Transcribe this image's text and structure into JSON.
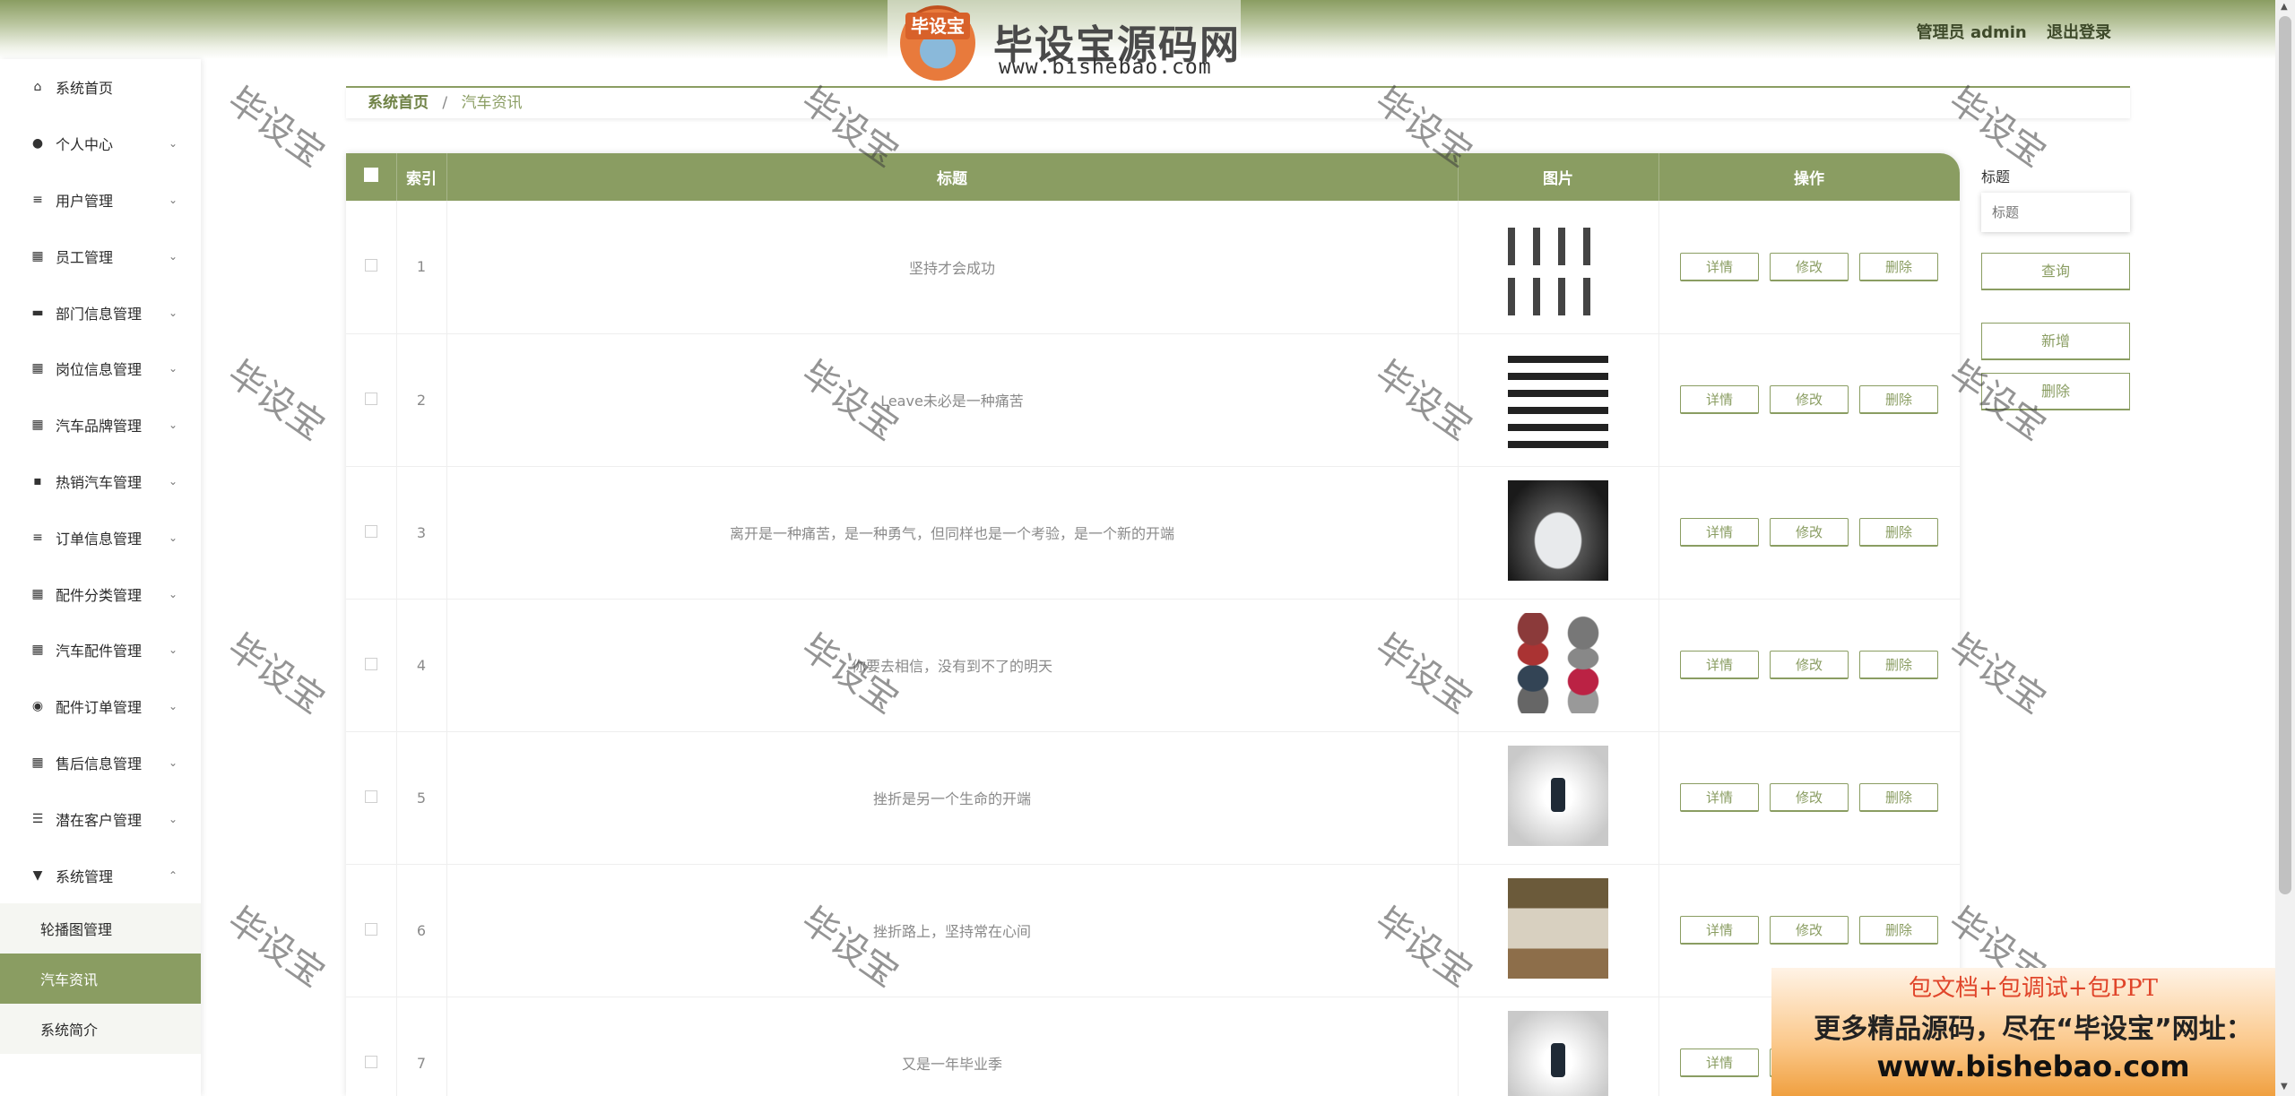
{
  "header": {
    "logo_badge": "毕设宝",
    "logo_title": "毕设宝源码网",
    "logo_url": "www.bishebao.com",
    "user_label": "管理员 admin",
    "logout_label": "退出登录"
  },
  "sidebar": {
    "items": [
      {
        "label": "系统首页",
        "icon": "home-icon",
        "glyph": "⌂",
        "chevron": ""
      },
      {
        "label": "个人中心",
        "icon": "user-icon",
        "glyph": "●",
        "chevron": "⌄"
      },
      {
        "label": "用户管理",
        "icon": "list-icon",
        "glyph": "≡",
        "chevron": "⌄"
      },
      {
        "label": "员工管理",
        "icon": "chart-icon",
        "glyph": "▦",
        "chevron": "⌄"
      },
      {
        "label": "部门信息管理",
        "icon": "ticket-icon",
        "glyph": "▬",
        "chevron": "⌄"
      },
      {
        "label": "岗位信息管理",
        "icon": "grid-icon",
        "glyph": "▦",
        "chevron": "⌄"
      },
      {
        "label": "汽车品牌管理",
        "icon": "grid-icon",
        "glyph": "▦",
        "chevron": "⌄"
      },
      {
        "label": "热销汽车管理",
        "icon": "comment-icon",
        "glyph": "▪",
        "chevron": "⌄"
      },
      {
        "label": "订单信息管理",
        "icon": "list-icon",
        "glyph": "≡",
        "chevron": "⌄"
      },
      {
        "label": "配件分类管理",
        "icon": "grid-icon",
        "glyph": "▦",
        "chevron": "⌄"
      },
      {
        "label": "汽车配件管理",
        "icon": "grid-icon",
        "glyph": "▦",
        "chevron": "⌄"
      },
      {
        "label": "配件订单管理",
        "icon": "location-icon",
        "glyph": "◉",
        "chevron": "⌄"
      },
      {
        "label": "售后信息管理",
        "icon": "grid-icon",
        "glyph": "▦",
        "chevron": "⌄"
      },
      {
        "label": "潜在客户管理",
        "icon": "sliders-icon",
        "glyph": "☰",
        "chevron": "⌄"
      },
      {
        "label": "系统管理",
        "icon": "settings-icon",
        "glyph": "▼",
        "chevron": "⌃"
      }
    ],
    "submenu": [
      {
        "label": "轮播图管理",
        "active": false
      },
      {
        "label": "汽车资讯",
        "active": true
      },
      {
        "label": "系统简介",
        "active": false
      }
    ]
  },
  "breadcrumb": {
    "home": "系统首页",
    "separator": "/",
    "current": "汽车资讯"
  },
  "table": {
    "headers": {
      "index": "索引",
      "title": "标题",
      "image": "图片",
      "actions": "操作"
    },
    "actions": {
      "detail": "详情",
      "edit": "修改",
      "delete": "删除"
    },
    "rows": [
      {
        "index": "1",
        "title": "坚持才会成功",
        "image": "cars-grid"
      },
      {
        "index": "2",
        "title": "Leave未必是一种痛苦",
        "image": "silhouettes"
      },
      {
        "index": "3",
        "title": "离开是一种痛苦，是一种勇气，但同样也是一个考验，是一个新的开端",
        "image": "suv"
      },
      {
        "index": "4",
        "title": "你要去相信，没有到不了的明天",
        "image": "colorful"
      },
      {
        "index": "5",
        "title": "挫折是另一个生命的开端",
        "image": "phone"
      },
      {
        "index": "6",
        "title": "挫折路上，坚持常在心间",
        "image": "offroad"
      },
      {
        "index": "7",
        "title": "又是一年毕业季",
        "image": "phone"
      }
    ]
  },
  "search": {
    "label": "标题",
    "placeholder": "标题",
    "query_button": "查询",
    "add_button": "新增",
    "delete_button": "删除"
  },
  "watermark": "毕设宝",
  "ad": {
    "line1": "包文档+包调试+包PPT",
    "line2": "更多精品源码，尽在“毕设宝”网址：",
    "line3": "www.bishebao.com"
  },
  "colors": {
    "accent": "#8a9d62",
    "header_gradient_top": "#8a9d62"
  }
}
